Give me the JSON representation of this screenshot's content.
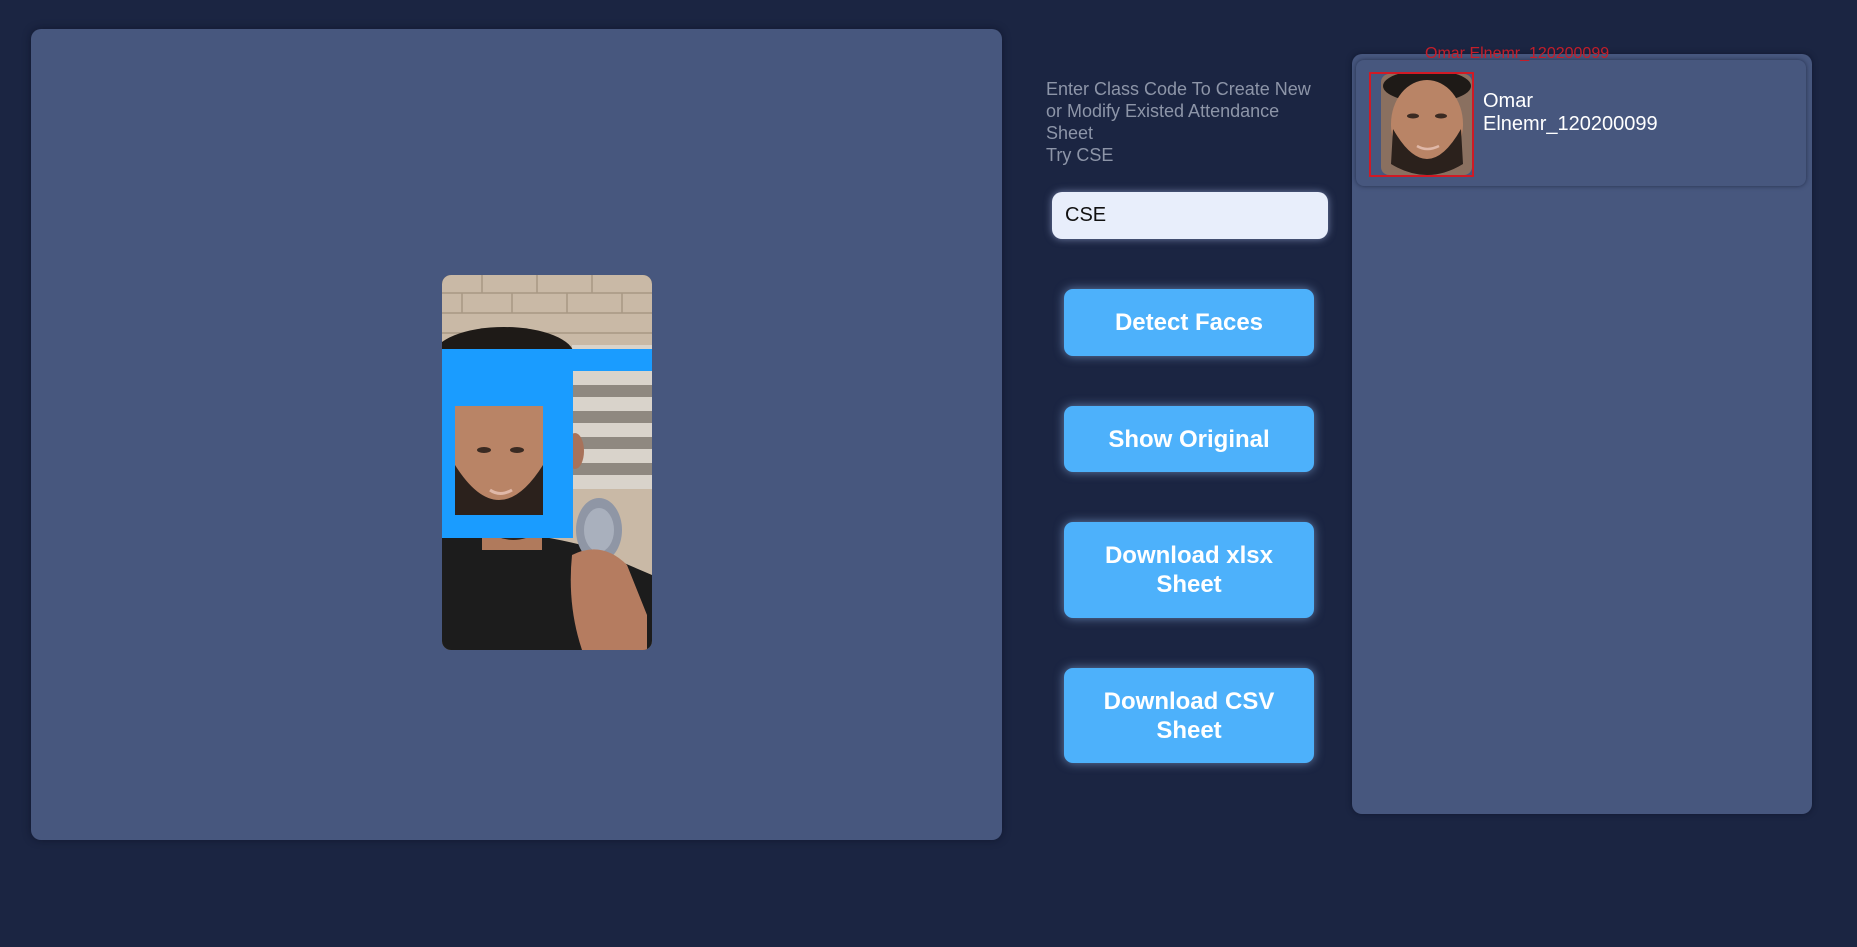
{
  "instruction": {
    "line1": "Enter Class Code To Create New\nor Modify Existed Attendance\nSheet",
    "line2": "Try CSE"
  },
  "class_code_input": {
    "value": "CSE"
  },
  "buttons": {
    "detect_faces": "Detect Faces",
    "show_original": "Show Original",
    "download_xlsx": "Download xlsx Sheet",
    "download_csv": "Download CSV Sheet"
  },
  "results": {
    "items": [
      {
        "overlay_label": "Omar Elnemr_120200099",
        "name": "Omar Elnemr_120200099"
      }
    ]
  },
  "colors": {
    "background": "#1b2542",
    "panel": "#47577e",
    "button": "#4db1fb",
    "detection_box": "#1a9cff",
    "match_box": "#d01a25"
  }
}
